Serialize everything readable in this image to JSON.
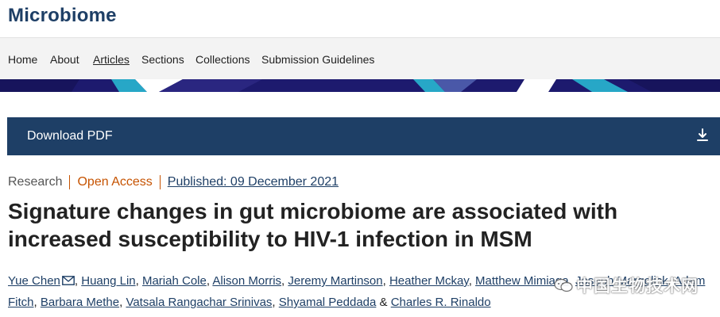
{
  "site": {
    "title": "Microbiome"
  },
  "nav": {
    "items": [
      {
        "label": "Home"
      },
      {
        "label": "About"
      },
      {
        "label": "Articles"
      },
      {
        "label": "Sections"
      },
      {
        "label": "Collections"
      },
      {
        "label": "Submission Guidelines"
      }
    ],
    "active": "Articles"
  },
  "download": {
    "label": "Download PDF",
    "icon": "download-icon"
  },
  "article": {
    "type": "Research",
    "access": "Open Access",
    "published": "Published: 09 December 2021",
    "title": "Signature changes in gut microbiome are associated with increased susceptibility to HIV-1 infection in MSM"
  },
  "authors": [
    "Yue Chen",
    "Huang Lin",
    "Mariah Cole",
    "Alison Morris",
    "Jeremy Martinson",
    "Heather Mckay",
    "Matthew Mimiaga",
    "Joseph Margolick",
    "Adam Fitch",
    "Barbara Methe",
    "Vatsala Rangachar Srinivas",
    "Shyamal Peddada",
    "Charles R. Rinaldo"
  ],
  "authors_sep": ", ",
  "authors_last_sep": " & ",
  "watermark": {
    "text": "中国生物技术网"
  },
  "colors": {
    "brand": "#1e3f66",
    "open_access": "#c65301",
    "banner": "#1d1a6e",
    "banner_accent": "#27a7c7"
  }
}
